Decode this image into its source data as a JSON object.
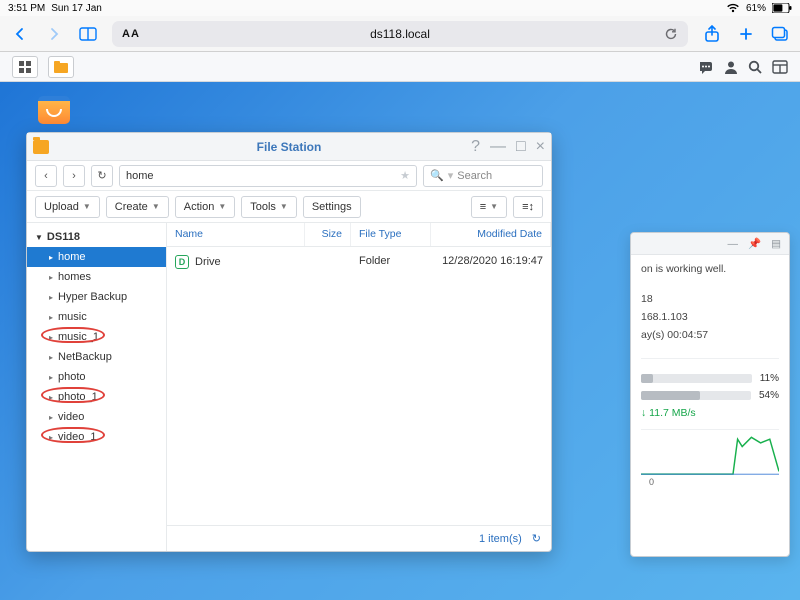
{
  "status_bar": {
    "time": "3:51 PM",
    "date": "Sun 17 Jan",
    "battery": "61%"
  },
  "safari": {
    "url": "ds118.local"
  },
  "file_station": {
    "title": "File Station",
    "path": "home",
    "search_placeholder": "Search",
    "toolbar": {
      "upload": "Upload",
      "create": "Create",
      "action": "Action",
      "tools": "Tools",
      "settings": "Settings"
    },
    "columns": {
      "name": "Name",
      "size": "Size",
      "type": "File Type",
      "date": "Modified Date"
    },
    "tree_root": "DS118",
    "tree": [
      {
        "label": "home",
        "active": true
      },
      {
        "label": "homes"
      },
      {
        "label": "Hyper Backup"
      },
      {
        "label": "music"
      },
      {
        "label": "music_1",
        "annot": true
      },
      {
        "label": "NetBackup"
      },
      {
        "label": "photo"
      },
      {
        "label": "photo_1",
        "annot": true
      },
      {
        "label": "video"
      },
      {
        "label": "video_1",
        "annot": true
      }
    ],
    "rows": [
      {
        "name": "Drive",
        "type": "Folder",
        "date": "12/28/2020 16:19:47"
      }
    ],
    "footer_count": "1 item(s)"
  },
  "widget": {
    "status_line": "on is working well.",
    "host_frag": "18",
    "ip_frag": "168.1.103",
    "uptime_frag": "ay(s) 00:04:57",
    "cpu_pct": "11%",
    "ram_pct": "54%",
    "net_down": "11.7 MB/s",
    "chart_x0": "0"
  }
}
